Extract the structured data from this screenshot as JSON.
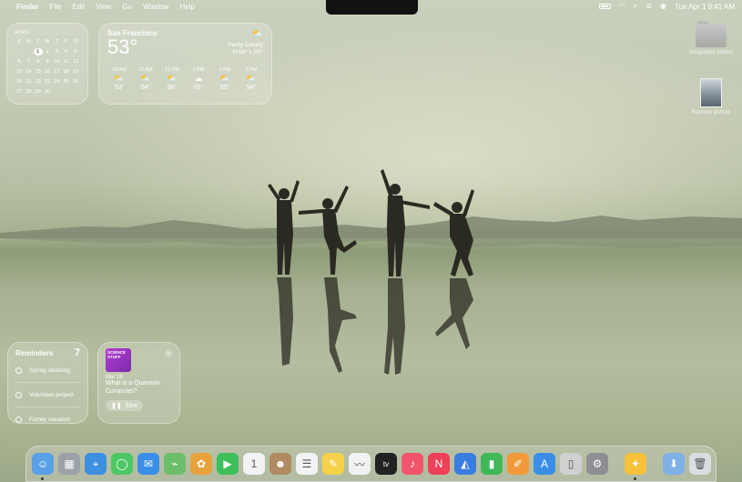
{
  "menubar": {
    "apple": "",
    "items": [
      "Finder",
      "File",
      "Edit",
      "View",
      "Go",
      "Window",
      "Help"
    ],
    "clock": "Tue Apr 1  9:41 AM"
  },
  "calendar": {
    "month": "APRIL",
    "weekdays": [
      "S",
      "M",
      "T",
      "W",
      "T",
      "F",
      "S"
    ],
    "days": [
      "",
      "",
      "1",
      "2",
      "3",
      "4",
      "5",
      "6",
      "7",
      "8",
      "9",
      "10",
      "11",
      "12",
      "13",
      "14",
      "15",
      "16",
      "17",
      "18",
      "19",
      "20",
      "21",
      "22",
      "23",
      "24",
      "25",
      "26",
      "27",
      "28",
      "29",
      "30",
      "",
      "",
      ""
    ],
    "today": "1"
  },
  "weather": {
    "city": "San Francisco",
    "temp": "53°",
    "condition": "Partly Cloudy",
    "hilo": "H:56° L:50°",
    "hours": [
      {
        "time": "10 AM",
        "temp": "53°",
        "icon": "partly-cloudy-icon"
      },
      {
        "time": "11 AM",
        "temp": "54°",
        "icon": "partly-cloudy-icon"
      },
      {
        "time": "12 PM",
        "temp": "56°",
        "icon": "partly-cloudy-icon"
      },
      {
        "time": "1 PM",
        "temp": "55°",
        "icon": "cloudy-icon"
      },
      {
        "time": "2 PM",
        "temp": "55°",
        "icon": "partly-cloudy-icon"
      },
      {
        "time": "3 PM",
        "temp": "54°",
        "icon": "partly-cloudy-icon"
      }
    ]
  },
  "reminders": {
    "title": "Reminders",
    "count": "7",
    "items": [
      "Spring cleaning",
      "Volunteer project",
      "Family vacation"
    ]
  },
  "podcast": {
    "art_text": "SCIENCE STUFF",
    "date": "Mar 19",
    "title": "What is a Quantum Computer?",
    "duration": "39m"
  },
  "desktop": {
    "items": [
      {
        "label": "Scrapbook photos",
        "icon": "folder-icon"
      },
      {
        "label": "Reunion portrait",
        "icon": "photo-file-icon"
      }
    ]
  },
  "dock": {
    "apps": [
      {
        "name": "finder",
        "glyph": "☺",
        "color": "#5aa0e6",
        "running": true
      },
      {
        "name": "launchpad",
        "glyph": "▦",
        "color": "#9aa2a8"
      },
      {
        "name": "safari",
        "glyph": "⌖",
        "color": "#3d8fe0"
      },
      {
        "name": "messages",
        "glyph": "◯",
        "color": "#4cc864"
      },
      {
        "name": "mail",
        "glyph": "✉",
        "color": "#3a8ee6"
      },
      {
        "name": "maps",
        "glyph": "⌁",
        "color": "#6dbe6a"
      },
      {
        "name": "photos",
        "glyph": "✿",
        "color": "#e8a23c"
      },
      {
        "name": "facetime",
        "glyph": "▶",
        "color": "#3fbf5a"
      },
      {
        "name": "calendar",
        "glyph": "1",
        "color": "#f2f2f2"
      },
      {
        "name": "contacts",
        "glyph": "☻",
        "color": "#b08a62"
      },
      {
        "name": "reminders",
        "glyph": "☰",
        "color": "#f2f2f2"
      },
      {
        "name": "notes",
        "glyph": "✎",
        "color": "#f5d24a"
      },
      {
        "name": "freeform",
        "glyph": "〰",
        "color": "#f2f2f2"
      },
      {
        "name": "tv",
        "glyph": "tv",
        "color": "#222222"
      },
      {
        "name": "music",
        "glyph": "♪",
        "color": "#f2556b"
      },
      {
        "name": "news",
        "glyph": "N",
        "color": "#ee4056"
      },
      {
        "name": "keynote",
        "glyph": "◭",
        "color": "#3a7de0"
      },
      {
        "name": "numbers",
        "glyph": "▮",
        "color": "#3fb85a"
      },
      {
        "name": "pages",
        "glyph": "✐",
        "color": "#f29a3a"
      },
      {
        "name": "app-store",
        "glyph": "A",
        "color": "#3a8ee6"
      },
      {
        "name": "iphone-mirroring",
        "glyph": "▯",
        "color": "#d0d0d0"
      },
      {
        "name": "system-settings",
        "glyph": "⚙",
        "color": "#8e8e93"
      }
    ],
    "recent": [
      {
        "name": "tips",
        "glyph": "✦",
        "color": "#f5c23a",
        "running": true
      }
    ],
    "trailing": [
      {
        "name": "downloads-folder",
        "glyph": "⬇",
        "color": "#7fb0e6"
      },
      {
        "name": "trash",
        "glyph": "🗑",
        "color": "#d9dde0"
      }
    ]
  }
}
